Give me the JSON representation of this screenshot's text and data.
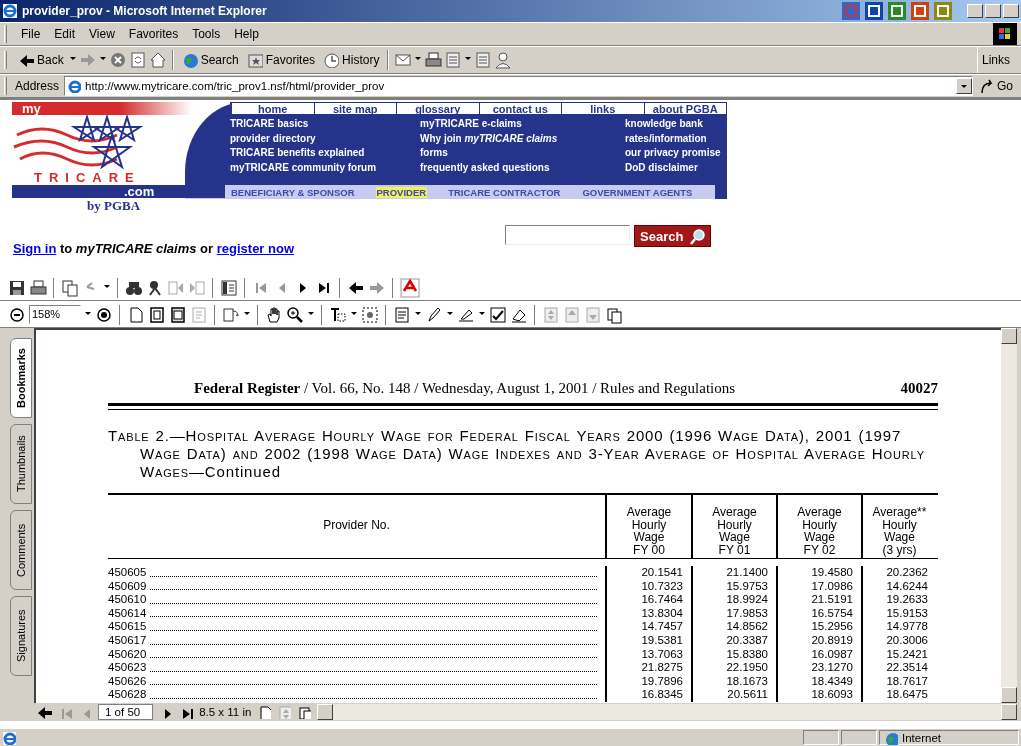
{
  "window": {
    "title": "provider_prov - Microsoft Internet Explorer"
  },
  "menu": [
    {
      "label": "File"
    },
    {
      "label": "Edit"
    },
    {
      "label": "View"
    },
    {
      "label": "Favorites"
    },
    {
      "label": "Tools"
    },
    {
      "label": "Help"
    }
  ],
  "toolbar": {
    "back": "Back",
    "search": "Search",
    "favorites": "Favorites",
    "history": "History",
    "links": "Links"
  },
  "address": {
    "label": "Address",
    "value": "http://www.mytricare.com/tric_prov1.nsf/html/provider_prov",
    "go": "Go"
  },
  "site": {
    "logo": {
      "my": "my",
      "brand": "TRICARE",
      "domain": ".com",
      "by": "by PGBA"
    },
    "nav": [
      {
        "label": "home"
      },
      {
        "label": "site map"
      },
      {
        "label": "glossary"
      },
      {
        "label": "contact us"
      },
      {
        "label": "links"
      },
      {
        "label": "about PGBA"
      }
    ],
    "link_columns": [
      [
        "TRICARE basics",
        "provider directory",
        "TRICARE benefits explained",
        "myTRICARE community forum"
      ],
      [
        "myTRICARE e-claims",
        "Why join *myTRICARE claims*",
        "forms",
        "frequently asked questions"
      ],
      [
        "knowledge bank",
        "rates/information",
        "our privacy promise",
        "DoD disclaimer"
      ]
    ],
    "audiences": [
      {
        "label": "BENEFICIARY & SPONSOR",
        "selected": false
      },
      {
        "label": "PROVIDER",
        "selected": true
      },
      {
        "label": "TRICARE CONTRACTOR",
        "selected": false
      },
      {
        "label": "GOVERNMENT AGENTS",
        "selected": false
      }
    ],
    "sign_in": {
      "link": "Sign in",
      "middle": "to *myTRICARE claims* or",
      "register": "register now"
    },
    "search": {
      "button": "Search"
    }
  },
  "viewer": {
    "zoom": "158%",
    "side_tabs": [
      {
        "label": "Bookmarks",
        "selected": true
      },
      {
        "label": "Thumbnails",
        "selected": false
      },
      {
        "label": "Comments",
        "selected": false
      },
      {
        "label": "Signatures",
        "selected": false
      }
    ],
    "page_position": "1 of 50",
    "page_size": "8.5 x 11 in"
  },
  "document": {
    "journal": "Federal Register",
    "running_head": "/ Vol. 66, No. 148 / Wednesday, August 1, 2001 / Rules and Regulations",
    "page": "40027",
    "table_title": "Table 2.—Hospital Average Hourly Wage for Federal Fiscal Years 2000 (1996 Wage Data), 2001 (1997 Wage Data) and 2002 (1998 Wage Data) Wage Indexes and 3-Year Average of Hospital Average Hourly Wages",
    "table_title_suffix": "—Continued",
    "columns": [
      "Provider No.",
      "Average\nHourly\nWage\nFY 00",
      "Average\nHourly\nWage\nFY 01",
      "Average\nHourly\nWage\nFY 02",
      "Average**\nHourly\nWage\n(3 yrs)"
    ],
    "rows": [
      [
        "450605",
        "20.1541",
        "21.1400",
        "19.4580",
        "20.2362"
      ],
      [
        "450609",
        "10.7323",
        "15.9753",
        "17.0986",
        "14.6244"
      ],
      [
        "450610",
        "16.7464",
        "18.9924",
        "21.5191",
        "19.2633"
      ],
      [
        "450614",
        "13.8304",
        "17.9853",
        "16.5754",
        "15.9153"
      ],
      [
        "450615",
        "14.7457",
        "14.8562",
        "15.2956",
        "14.9778"
      ],
      [
        "450617",
        "19.5381",
        "20.3387",
        "20.8919",
        "20.3006"
      ],
      [
        "450620",
        "13.7063",
        "15.8380",
        "16.0987",
        "15.2421"
      ],
      [
        "450623",
        "21.8275",
        "22.1950",
        "23.1270",
        "22.3514"
      ],
      [
        "450626",
        "19.7896",
        "18.1673",
        "18.4349",
        "18.7617"
      ],
      [
        "450628",
        "16.8345",
        "20.5611",
        "18.6093",
        "18.6475"
      ]
    ]
  },
  "status_bar": {
    "zone": "Internet"
  }
}
